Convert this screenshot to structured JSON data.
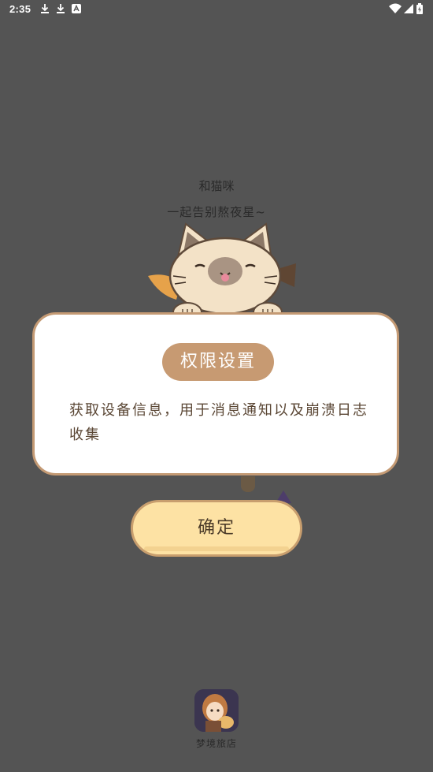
{
  "status_bar": {
    "time": "2:35",
    "icons": [
      "download-icon",
      "download-icon",
      "app-notification-icon",
      "wifi-icon",
      "signal-icon",
      "battery-icon"
    ]
  },
  "splash": {
    "line1": "和猫咪",
    "line2": "一起告别熬夜星~"
  },
  "dialog": {
    "title": "权限设置",
    "body": "获取设备信息，用于消息通知以及崩溃日志收集"
  },
  "confirm_button": {
    "label": "确定"
  },
  "app": {
    "name": "梦境旅店"
  },
  "colors": {
    "background": "#545454",
    "dialog_border": "#c49a74",
    "title_badge": "#c79a72",
    "button_fill": "#fde2a4"
  }
}
